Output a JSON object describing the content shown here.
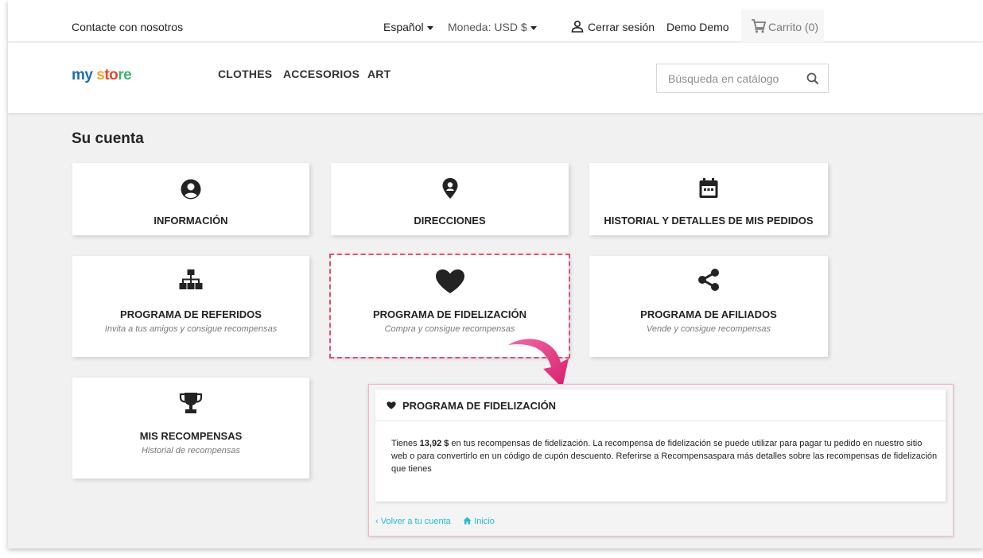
{
  "topbar": {
    "contact": "Contacte con nosotros",
    "language": "Español",
    "currency": "Moneda: USD $",
    "logout": "Cerrar sesión",
    "user": "Demo Demo",
    "cart": "Carrito (0)"
  },
  "header": {
    "logo": {
      "p1": "my ",
      "p2": "s",
      "p3": "to",
      "p4": "re"
    },
    "nav": [
      "CLOTHES",
      "ACCESORIOS",
      "ART"
    ],
    "search_placeholder": "Búsqueda en catálogo"
  },
  "page": {
    "title": "Su cuenta",
    "cards": {
      "info": {
        "title": "INFORMACIÓN",
        "icon": "user-circle-icon"
      },
      "addresses": {
        "title": "DIRECCIONES",
        "icon": "location-pin-icon"
      },
      "orders": {
        "title": "HISTORIAL Y DETALLES DE MIS PEDIDOS",
        "icon": "calendar-icon"
      },
      "referral": {
        "title": "PROGRAMA DE REFERIDOS",
        "subtitle": "Invita a tus amigos y consigue recompensas",
        "icon": "sitemap-icon"
      },
      "loyalty": {
        "title": "PROGRAMA DE FIDELIZACIÓN",
        "subtitle": "Compra y consigue recompensas",
        "icon": "heart-icon"
      },
      "affiliate": {
        "title": "PROGRAMA DE AFILIADOS",
        "subtitle": "Vende y consigue recompensas",
        "icon": "share-icon"
      },
      "rewards": {
        "title": "MIS RECOMPENSAS",
        "subtitle": "Historial de recompensas",
        "icon": "trophy-icon"
      }
    }
  },
  "loyalty_panel": {
    "title": "PROGRAMA DE FIDELIZACIÓN",
    "body_pre": "Tienes ",
    "amount": "13,92 $",
    "body_post": " en tus recompensas de fidelización. La recompensa de fidelización se puede utilizar para pagar tu pedido en nuestro sitio web o para convertirlo en un código de cupón descuento. Referirse a Recompensaspara más detalles sobre las recompensas de fidelización que tienes",
    "back_link": "Volver a tu cuenta",
    "home_link": "Inicio"
  },
  "colors": {
    "accent_link": "#24b9d7",
    "highlight": "#e0506f",
    "arrow": "#e8357e"
  }
}
